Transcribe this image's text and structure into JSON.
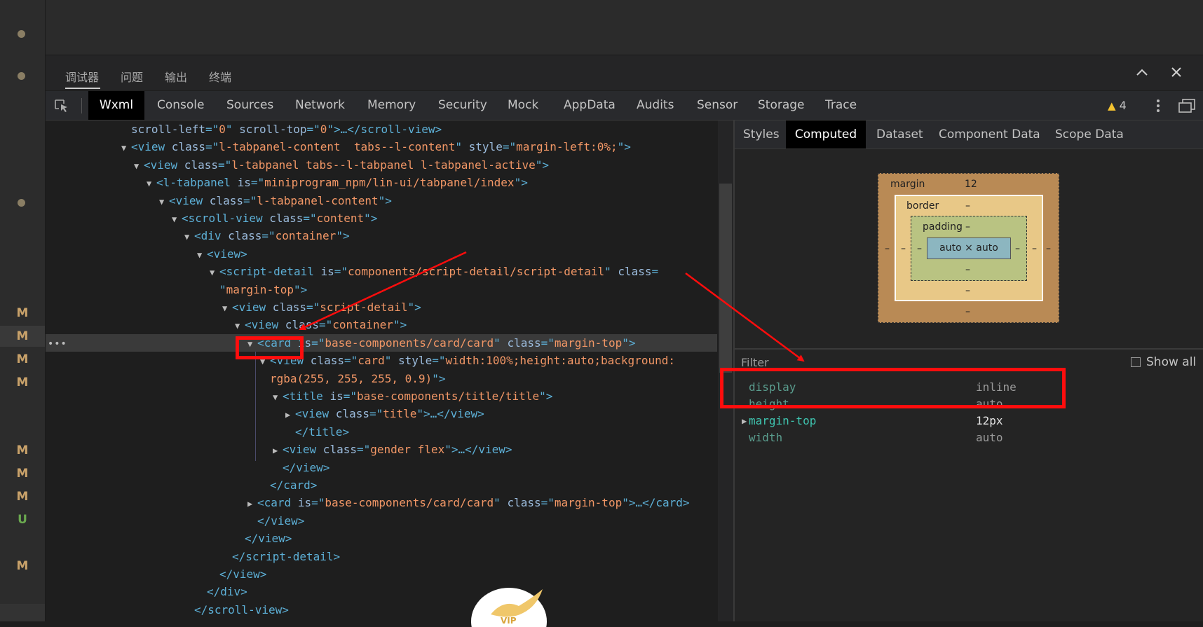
{
  "gutter": {
    "markers": [
      {
        "label": "M",
        "type": "modified",
        "highlight": false
      },
      {
        "label": "M",
        "type": "modified",
        "highlight": true
      },
      {
        "label": "M",
        "type": "modified",
        "highlight": false
      },
      {
        "label": "M",
        "type": "modified",
        "highlight": false
      },
      {
        "label": "M",
        "type": "modified",
        "highlight": false
      },
      {
        "label": "M",
        "type": "modified",
        "highlight": false
      },
      {
        "label": "M",
        "type": "modified",
        "highlight": false
      },
      {
        "label": "U",
        "type": "untracked",
        "highlight": false
      },
      {
        "label": "M",
        "type": "modified",
        "highlight": false
      }
    ]
  },
  "panel_tabs": [
    "调试器",
    "问题",
    "输出",
    "终端"
  ],
  "active_panel_tab": "调试器",
  "toolbar": {
    "tabs": [
      "Wxml",
      "Console",
      "Sources",
      "Network",
      "Memory",
      "Security",
      "Mock",
      "AppData",
      "Audits",
      "Sensor",
      "Storage",
      "Trace"
    ],
    "active_tab": "Wxml",
    "warning_count": "4",
    "icons": [
      "inspect-element-icon",
      "warning-icon",
      "more-vert-icon",
      "dock-side-icon",
      "chevron-up-icon",
      "close-icon"
    ]
  },
  "dom_tree": {
    "lines": [
      {
        "indent": 6,
        "toggle": "",
        "tokens": [
          [
            "attr",
            "scroll-left"
          ],
          [
            "punc",
            "=\""
          ],
          [
            "val",
            "0"
          ],
          [
            "punc",
            "\" "
          ],
          [
            "attr",
            "scroll-top"
          ],
          [
            "punc",
            "=\""
          ],
          [
            "val",
            "0"
          ],
          [
            "punc",
            "\">…</"
          ],
          [
            "tag",
            "scroll-view"
          ],
          [
            "punc",
            ">"
          ]
        ]
      },
      {
        "indent": 6,
        "toggle": "open",
        "tokens": [
          [
            "punc",
            "<"
          ],
          [
            "tag",
            "view"
          ],
          [
            "attr",
            " class"
          ],
          [
            "punc",
            "=\""
          ],
          [
            "val",
            "l-tabpanel-content  tabs--l-content"
          ],
          [
            "punc",
            "\" "
          ],
          [
            "attr",
            "style"
          ],
          [
            "punc",
            "=\""
          ],
          [
            "val",
            "margin-left:0%;"
          ],
          [
            "punc",
            "\">"
          ]
        ]
      },
      {
        "indent": 7,
        "toggle": "open",
        "tokens": [
          [
            "punc",
            "<"
          ],
          [
            "tag",
            "view"
          ],
          [
            "attr",
            " class"
          ],
          [
            "punc",
            "=\""
          ],
          [
            "val",
            "l-tabpanel tabs--l-tabpanel l-tabpanel-active"
          ],
          [
            "punc",
            "\">"
          ]
        ]
      },
      {
        "indent": 8,
        "toggle": "open",
        "tokens": [
          [
            "punc",
            "<"
          ],
          [
            "tag",
            "l-tabpanel"
          ],
          [
            "attr",
            " is"
          ],
          [
            "punc",
            "=\""
          ],
          [
            "val",
            "miniprogram_npm/lin-ui/tabpanel/index"
          ],
          [
            "punc",
            "\">"
          ]
        ]
      },
      {
        "indent": 9,
        "toggle": "open",
        "tokens": [
          [
            "punc",
            "<"
          ],
          [
            "tag",
            "view"
          ],
          [
            "attr",
            " class"
          ],
          [
            "punc",
            "=\""
          ],
          [
            "val",
            "l-tabpanel-content"
          ],
          [
            "punc",
            "\">"
          ]
        ]
      },
      {
        "indent": 10,
        "toggle": "open",
        "tokens": [
          [
            "punc",
            "<"
          ],
          [
            "tag",
            "scroll-view"
          ],
          [
            "attr",
            " class"
          ],
          [
            "punc",
            "=\""
          ],
          [
            "val",
            "content"
          ],
          [
            "punc",
            "\">"
          ]
        ]
      },
      {
        "indent": 11,
        "toggle": "open",
        "tokens": [
          [
            "punc",
            "<"
          ],
          [
            "tag",
            "div"
          ],
          [
            "attr",
            " class"
          ],
          [
            "punc",
            "=\""
          ],
          [
            "val",
            "container"
          ],
          [
            "punc",
            "\">"
          ]
        ]
      },
      {
        "indent": 12,
        "toggle": "open",
        "tokens": [
          [
            "punc",
            "<"
          ],
          [
            "tag",
            "view"
          ],
          [
            "punc",
            ">"
          ]
        ]
      },
      {
        "indent": 13,
        "toggle": "open",
        "tokens": [
          [
            "punc",
            "<"
          ],
          [
            "tag",
            "script-detail"
          ],
          [
            "attr",
            " is"
          ],
          [
            "punc",
            "=\""
          ],
          [
            "val",
            "components/script-detail/script-detail"
          ],
          [
            "punc",
            "\" "
          ],
          [
            "attr",
            "class"
          ],
          [
            "punc",
            "="
          ]
        ]
      },
      {
        "indent": 13,
        "toggle": "",
        "tokens": [
          [
            "punc",
            "\""
          ],
          [
            "val",
            "margin-top"
          ],
          [
            "punc",
            "\">"
          ]
        ]
      },
      {
        "indent": 14,
        "toggle": "open",
        "tokens": [
          [
            "punc",
            "<"
          ],
          [
            "tag",
            "view"
          ],
          [
            "attr",
            " class"
          ],
          [
            "punc",
            "=\""
          ],
          [
            "val",
            "script-detail"
          ],
          [
            "punc",
            "\">"
          ]
        ]
      },
      {
        "indent": 15,
        "toggle": "open",
        "tokens": [
          [
            "punc",
            "<"
          ],
          [
            "tag",
            "view"
          ],
          [
            "attr",
            " class"
          ],
          [
            "punc",
            "=\""
          ],
          [
            "val",
            "container"
          ],
          [
            "punc",
            "\">"
          ]
        ]
      },
      {
        "indent": 16,
        "toggle": "open",
        "selected": true,
        "tokens": [
          [
            "punc",
            "<"
          ],
          [
            "tag",
            "card"
          ],
          [
            "attr",
            " is"
          ],
          [
            "punc",
            "=\""
          ],
          [
            "val",
            "base-components/card/card"
          ],
          [
            "punc",
            "\" "
          ],
          [
            "attr",
            "class"
          ],
          [
            "punc",
            "=\""
          ],
          [
            "val",
            "margin-top"
          ],
          [
            "punc",
            "\">"
          ]
        ]
      },
      {
        "indent": 17,
        "toggle": "open",
        "tokens": [
          [
            "punc",
            "<"
          ],
          [
            "tag",
            "view"
          ],
          [
            "attr",
            " class"
          ],
          [
            "punc",
            "=\""
          ],
          [
            "val",
            "card"
          ],
          [
            "punc",
            "\" "
          ],
          [
            "attr",
            "style"
          ],
          [
            "punc",
            "=\""
          ],
          [
            "val",
            "width:100%;height:auto;background:"
          ]
        ]
      },
      {
        "indent": 17,
        "toggle": "",
        "tokens": [
          [
            "val",
            "rgba(255, 255, 255, 0.9)"
          ],
          [
            "punc",
            "\">"
          ]
        ]
      },
      {
        "indent": 18,
        "toggle": "open",
        "tokens": [
          [
            "punc",
            "<"
          ],
          [
            "tag",
            "title"
          ],
          [
            "attr",
            " is"
          ],
          [
            "punc",
            "=\""
          ],
          [
            "val",
            "base-components/title/title"
          ],
          [
            "punc",
            "\">"
          ]
        ]
      },
      {
        "indent": 19,
        "toggle": "closed",
        "tokens": [
          [
            "punc",
            "<"
          ],
          [
            "tag",
            "view"
          ],
          [
            "attr",
            " class"
          ],
          [
            "punc",
            "=\""
          ],
          [
            "val",
            "title"
          ],
          [
            "punc",
            "\">…</"
          ],
          [
            "tag",
            "view"
          ],
          [
            "punc",
            ">"
          ]
        ]
      },
      {
        "indent": 19,
        "toggle": "",
        "tokens": [
          [
            "punc",
            "</"
          ],
          [
            "tag",
            "title"
          ],
          [
            "punc",
            ">"
          ]
        ]
      },
      {
        "indent": 18,
        "toggle": "closed",
        "tokens": [
          [
            "punc",
            "<"
          ],
          [
            "tag",
            "view"
          ],
          [
            "attr",
            " class"
          ],
          [
            "punc",
            "=\""
          ],
          [
            "val",
            "gender flex"
          ],
          [
            "punc",
            "\">…</"
          ],
          [
            "tag",
            "view"
          ],
          [
            "punc",
            ">"
          ]
        ]
      },
      {
        "indent": 18,
        "toggle": "",
        "tokens": [
          [
            "punc",
            "</"
          ],
          [
            "tag",
            "view"
          ],
          [
            "punc",
            ">"
          ]
        ]
      },
      {
        "indent": 17,
        "toggle": "",
        "tokens": [
          [
            "punc",
            "</"
          ],
          [
            "tag",
            "card"
          ],
          [
            "punc",
            ">"
          ]
        ]
      },
      {
        "indent": 16,
        "toggle": "closed",
        "tokens": [
          [
            "punc",
            "<"
          ],
          [
            "tag",
            "card"
          ],
          [
            "attr",
            " is"
          ],
          [
            "punc",
            "=\""
          ],
          [
            "val",
            "base-components/card/card"
          ],
          [
            "punc",
            "\" "
          ],
          [
            "attr",
            "class"
          ],
          [
            "punc",
            "=\""
          ],
          [
            "val",
            "margin-top"
          ],
          [
            "punc",
            "\">…</"
          ],
          [
            "tag",
            "card"
          ],
          [
            "punc",
            ">"
          ]
        ]
      },
      {
        "indent": 16,
        "toggle": "",
        "tokens": [
          [
            "punc",
            "</"
          ],
          [
            "tag",
            "view"
          ],
          [
            "punc",
            ">"
          ]
        ]
      },
      {
        "indent": 15,
        "toggle": "",
        "tokens": [
          [
            "punc",
            "</"
          ],
          [
            "tag",
            "view"
          ],
          [
            "punc",
            ">"
          ]
        ]
      },
      {
        "indent": 14,
        "toggle": "",
        "tokens": [
          [
            "punc",
            "</"
          ],
          [
            "tag",
            "script-detail"
          ],
          [
            "punc",
            ">"
          ]
        ]
      },
      {
        "indent": 13,
        "toggle": "",
        "tokens": [
          [
            "punc",
            "</"
          ],
          [
            "tag",
            "view"
          ],
          [
            "punc",
            ">"
          ]
        ]
      },
      {
        "indent": 12,
        "toggle": "",
        "tokens": [
          [
            "punc",
            "</"
          ],
          [
            "tag",
            "div"
          ],
          [
            "punc",
            ">"
          ]
        ]
      },
      {
        "indent": 11,
        "toggle": "",
        "tokens": [
          [
            "punc",
            "</"
          ],
          [
            "tag",
            "scroll-view"
          ],
          [
            "punc",
            ">"
          ]
        ]
      }
    ]
  },
  "right_tabs": [
    "Styles",
    "Computed",
    "Dataset",
    "Component Data",
    "Scope Data"
  ],
  "active_right_tab": "Computed",
  "box_model": {
    "margin_label": "margin",
    "margin_top": "12",
    "margin_left": "–",
    "margin_right": "–",
    "margin_bottom": "–",
    "border_label": "border",
    "border_top": "–",
    "border_left": "–",
    "border_right": "–",
    "border_bottom": "–",
    "padding_label": "padding",
    "padding_top": "–",
    "padding_left": "–",
    "padding_right": "–",
    "padding_bottom": "–",
    "content": "auto × auto",
    "colors": {
      "margin": "#b98a55",
      "border": "#e8c887",
      "padding": "#b9c382",
      "content": "#8cb6c0"
    }
  },
  "filter": {
    "label": "Filter",
    "show_all": "Show all"
  },
  "computed": [
    {
      "name": "display",
      "value": "inline",
      "strong": false,
      "expandable": false
    },
    {
      "name": "height",
      "value": "auto",
      "strong": false,
      "expandable": false
    },
    {
      "name": "margin-top",
      "value": "12px",
      "strong": true,
      "expandable": true
    },
    {
      "name": "width",
      "value": "auto",
      "strong": false,
      "expandable": false
    }
  ],
  "annotation_color": "#ff0d0d",
  "watermark_logo": "VIP"
}
